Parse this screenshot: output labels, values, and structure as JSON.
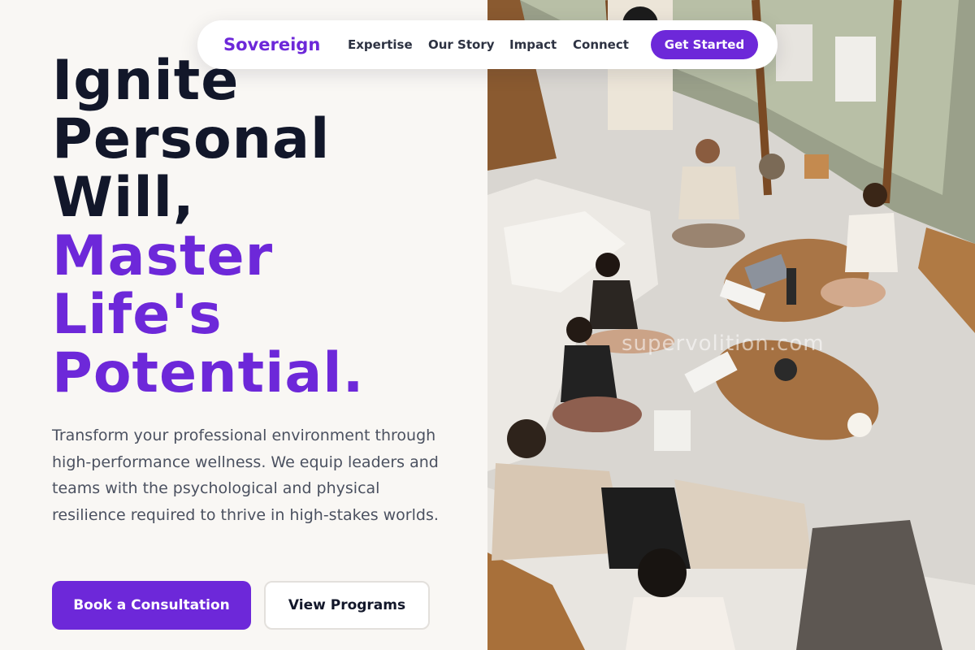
{
  "nav": {
    "brand": "Sovereign",
    "links": [
      "Expertise",
      "Our Story",
      "Impact",
      "Connect"
    ],
    "cta": "Get Started"
  },
  "hero": {
    "headline_dark": [
      "Ignite",
      "Personal",
      "Will,"
    ],
    "headline_accent": [
      "Master",
      "Life's",
      "Potential."
    ],
    "subcopy": "Transform your professional environment through high-performance wellness. We equip leaders and teams with the psychological and physical resilience required to thrive in high-stakes worlds.",
    "primary_button": "Book a Consultation",
    "secondary_button": "View Programs"
  },
  "photo": {
    "watermark": "supervolition.com"
  },
  "colors": {
    "accent": "#6d28d9",
    "heading": "#12172a",
    "body_text": "#4b5160",
    "background": "#f9f7f4"
  }
}
